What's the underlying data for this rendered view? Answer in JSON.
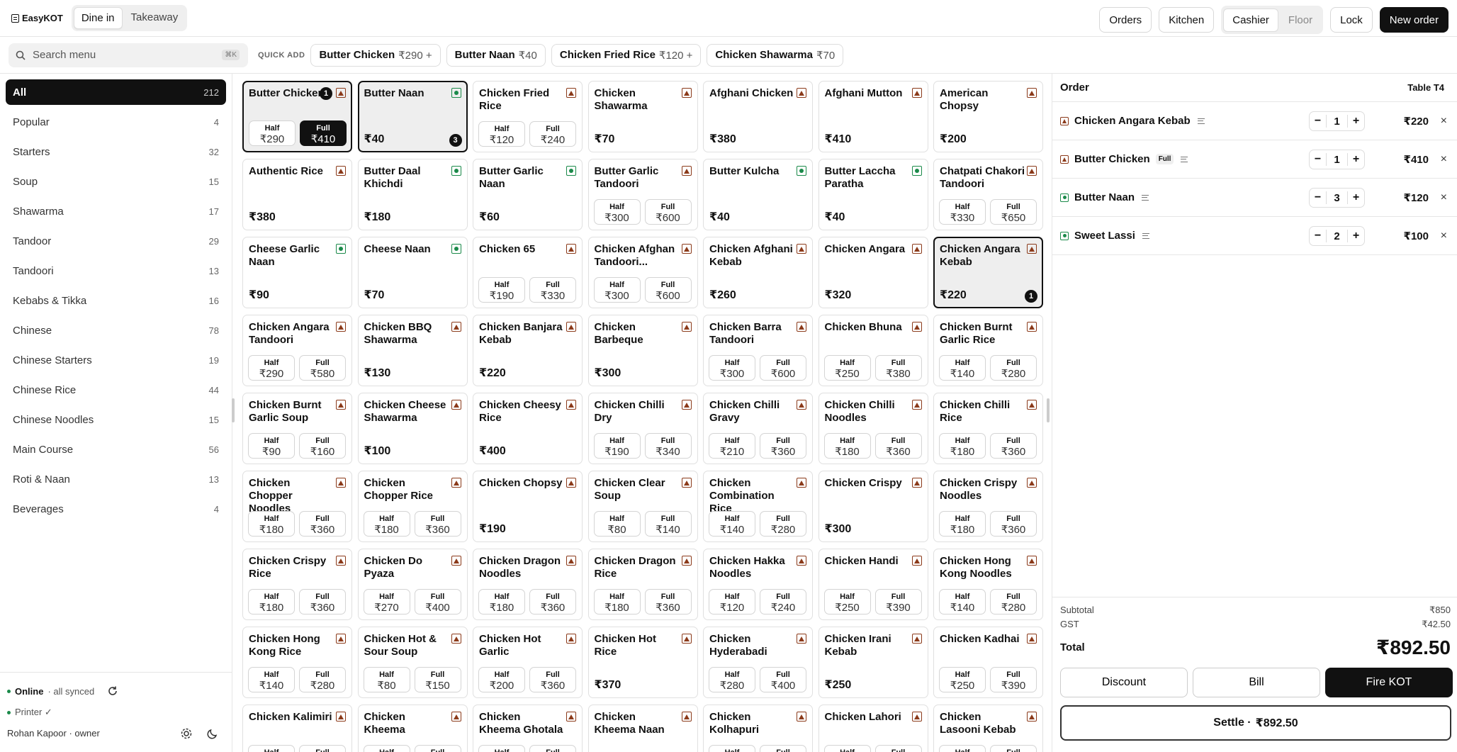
{
  "brand": {
    "name": "EasyKOT"
  },
  "mode_tabs": [
    "Dine in",
    "Takeaway"
  ],
  "header": {
    "orders": "Orders",
    "kitchen": "Kitchen",
    "role_tabs": [
      "Cashier",
      "Floor"
    ],
    "lock": "Lock",
    "new_order": "New order"
  },
  "search": {
    "placeholder": "Search menu",
    "shortcut": "⌘K"
  },
  "quick_add": {
    "label": "QUICK ADD",
    "items": [
      {
        "name": "Butter Chicken",
        "price": "₹290 +"
      },
      {
        "name": "Butter Naan",
        "price": "₹40"
      },
      {
        "name": "Chicken Fried Rice",
        "price": "₹120 +"
      },
      {
        "name": "Chicken Shawarma",
        "price": "₹70"
      }
    ]
  },
  "categories": [
    {
      "name": "All",
      "count": "212"
    },
    {
      "name": "Popular",
      "count": "4"
    },
    {
      "name": "Starters",
      "count": "32"
    },
    {
      "name": "Soup",
      "count": "15"
    },
    {
      "name": "Shawarma",
      "count": "17"
    },
    {
      "name": "Tandoor",
      "count": "29"
    },
    {
      "name": "Tandoori",
      "count": "13"
    },
    {
      "name": "Kebabs & Tikka",
      "count": "16"
    },
    {
      "name": "Chinese",
      "count": "78"
    },
    {
      "name": "Chinese Starters",
      "count": "19"
    },
    {
      "name": "Chinese Rice",
      "count": "44"
    },
    {
      "name": "Chinese Noodles",
      "count": "15"
    },
    {
      "name": "Main Course",
      "count": "56"
    },
    {
      "name": "Roti & Naan",
      "count": "13"
    },
    {
      "name": "Beverages",
      "count": "4"
    }
  ],
  "status": {
    "online": "Online",
    "synced": "· all synced",
    "printer": "Printer ✓",
    "user": "Rohan Kapoor · owner"
  },
  "portion_labels": {
    "half": "Half",
    "full": "Full"
  },
  "menu": [
    {
      "name": "Butter Chicken",
      "veg": false,
      "half": "₹290",
      "full": "₹410",
      "selected": true,
      "badge": "1",
      "full_active": true
    },
    {
      "name": "Butter Naan",
      "veg": true,
      "price": "₹40",
      "selected": true,
      "badge": "3"
    },
    {
      "name": "Chicken Fried Rice",
      "veg": false,
      "half": "₹120",
      "full": "₹240"
    },
    {
      "name": "Chicken Shawarma",
      "veg": false,
      "price": "₹70"
    },
    {
      "name": "Afghani Chicken",
      "veg": false,
      "price": "₹380"
    },
    {
      "name": "Afghani Mutton",
      "veg": false,
      "price": "₹410"
    },
    {
      "name": "American Chopsy",
      "veg": false,
      "price": "₹200"
    },
    {
      "name": "Authentic Rice",
      "veg": false,
      "price": "₹380"
    },
    {
      "name": "Butter Daal Khichdi",
      "veg": true,
      "price": "₹180"
    },
    {
      "name": "Butter Garlic Naan",
      "veg": true,
      "price": "₹60"
    },
    {
      "name": "Butter Garlic Tandoori",
      "veg": false,
      "half": "₹300",
      "full": "₹600"
    },
    {
      "name": "Butter Kulcha",
      "veg": true,
      "price": "₹40"
    },
    {
      "name": "Butter Laccha Paratha",
      "veg": true,
      "price": "₹40"
    },
    {
      "name": "Chatpati Chakori Tandoori",
      "veg": false,
      "half": "₹330",
      "full": "₹650"
    },
    {
      "name": "Cheese Garlic Naan",
      "veg": true,
      "price": "₹90"
    },
    {
      "name": "Cheese Naan",
      "veg": true,
      "price": "₹70"
    },
    {
      "name": "Chicken 65",
      "veg": false,
      "half": "₹190",
      "full": "₹330"
    },
    {
      "name": "Chicken Afghan Tandoori...",
      "veg": false,
      "half": "₹300",
      "full": "₹600"
    },
    {
      "name": "Chicken Afghani Kebab",
      "veg": false,
      "price": "₹260"
    },
    {
      "name": "Chicken Angara",
      "veg": false,
      "price": "₹320"
    },
    {
      "name": "Chicken Angara Kebab",
      "veg": false,
      "price": "₹220",
      "selected": true,
      "badge": "1"
    },
    {
      "name": "Chicken Angara Tandoori",
      "veg": false,
      "half": "₹290",
      "full": "₹580"
    },
    {
      "name": "Chicken BBQ Shawarma",
      "veg": false,
      "price": "₹130"
    },
    {
      "name": "Chicken Banjara Kebab",
      "veg": false,
      "price": "₹220"
    },
    {
      "name": "Chicken Barbeque",
      "veg": false,
      "price": "₹300"
    },
    {
      "name": "Chicken Barra Tandoori",
      "veg": false,
      "half": "₹300",
      "full": "₹600"
    },
    {
      "name": "Chicken Bhuna",
      "veg": false,
      "half": "₹250",
      "full": "₹380"
    },
    {
      "name": "Chicken Burnt Garlic Rice",
      "veg": false,
      "half": "₹140",
      "full": "₹280"
    },
    {
      "name": "Chicken Burnt Garlic Soup",
      "veg": false,
      "half": "₹90",
      "full": "₹160"
    },
    {
      "name": "Chicken Cheese Shawarma",
      "veg": false,
      "price": "₹100"
    },
    {
      "name": "Chicken Cheesy Rice",
      "veg": false,
      "price": "₹400"
    },
    {
      "name": "Chicken Chilli Dry",
      "veg": false,
      "half": "₹190",
      "full": "₹340"
    },
    {
      "name": "Chicken Chilli Gravy",
      "veg": false,
      "half": "₹210",
      "full": "₹360"
    },
    {
      "name": "Chicken Chilli Noodles",
      "veg": false,
      "half": "₹180",
      "full": "₹360"
    },
    {
      "name": "Chicken Chilli Rice",
      "veg": false,
      "half": "₹180",
      "full": "₹360"
    },
    {
      "name": "Chicken Chopper Noodles",
      "veg": false,
      "half": "₹180",
      "full": "₹360"
    },
    {
      "name": "Chicken Chopper Rice",
      "veg": false,
      "half": "₹180",
      "full": "₹360"
    },
    {
      "name": "Chicken Chopsy",
      "veg": false,
      "price": "₹190"
    },
    {
      "name": "Chicken Clear Soup",
      "veg": false,
      "half": "₹80",
      "full": "₹140"
    },
    {
      "name": "Chicken Combination Rice",
      "veg": false,
      "half": "₹140",
      "full": "₹280"
    },
    {
      "name": "Chicken Crispy",
      "veg": false,
      "price": "₹300"
    },
    {
      "name": "Chicken Crispy Noodles",
      "veg": false,
      "half": "₹180",
      "full": "₹360"
    },
    {
      "name": "Chicken Crispy Rice",
      "veg": false,
      "half": "₹180",
      "full": "₹360"
    },
    {
      "name": "Chicken Do Pyaza",
      "veg": false,
      "half": "₹270",
      "full": "₹400"
    },
    {
      "name": "Chicken Dragon Noodles",
      "veg": false,
      "half": "₹180",
      "full": "₹360"
    },
    {
      "name": "Chicken Dragon Rice",
      "veg": false,
      "half": "₹180",
      "full": "₹360"
    },
    {
      "name": "Chicken Hakka Noodles",
      "veg": false,
      "half": "₹120",
      "full": "₹240"
    },
    {
      "name": "Chicken Handi",
      "veg": false,
      "half": "₹250",
      "full": "₹390"
    },
    {
      "name": "Chicken Hong Kong Noodles",
      "veg": false,
      "half": "₹140",
      "full": "₹280"
    },
    {
      "name": "Chicken Hong Kong Rice",
      "veg": false,
      "half": "₹140",
      "full": "₹280"
    },
    {
      "name": "Chicken Hot & Sour Soup",
      "veg": false,
      "half": "₹80",
      "full": "₹150"
    },
    {
      "name": "Chicken Hot Garlic",
      "veg": false,
      "half": "₹200",
      "full": "₹360"
    },
    {
      "name": "Chicken Hot Rice",
      "veg": false,
      "price": "₹370"
    },
    {
      "name": "Chicken Hyderabadi",
      "veg": false,
      "half": "₹280",
      "full": "₹400"
    },
    {
      "name": "Chicken Irani Kebab",
      "veg": false,
      "price": "₹250"
    },
    {
      "name": "Chicken Kadhai",
      "veg": false,
      "half": "₹250",
      "full": "₹390"
    },
    {
      "name": "Chicken Kalimiri",
      "veg": false,
      "half": "",
      "full": ""
    },
    {
      "name": "Chicken Kheema",
      "veg": false,
      "half": "",
      "full": ""
    },
    {
      "name": "Chicken Kheema Ghotala",
      "veg": false,
      "half": "",
      "full": ""
    },
    {
      "name": "Chicken Kheema Naan",
      "veg": false,
      "price": ""
    },
    {
      "name": "Chicken Kolhapuri",
      "veg": false,
      "half": "",
      "full": ""
    },
    {
      "name": "Chicken Lahori",
      "veg": false,
      "half": "",
      "full": ""
    },
    {
      "name": "Chicken Lasooni Kebab",
      "veg": false,
      "half": "",
      "full": ""
    }
  ],
  "order": {
    "title": "Order",
    "table": "Table T4",
    "lines": [
      {
        "name": "Chicken Angara Kebab",
        "veg": false,
        "variant": "",
        "qty": "1",
        "price": "₹220"
      },
      {
        "name": "Butter Chicken",
        "veg": false,
        "variant": "Full",
        "qty": "1",
        "price": "₹410"
      },
      {
        "name": "Butter Naan",
        "veg": true,
        "variant": "",
        "qty": "3",
        "price": "₹120"
      },
      {
        "name": "Sweet Lassi",
        "veg": true,
        "variant": "",
        "qty": "2",
        "price": "₹100"
      }
    ],
    "subtotal_label": "Subtotal",
    "subtotal": "₹850",
    "gst_label": "GST",
    "gst": "₹42.50",
    "total_label": "Total",
    "total": "₹892.50",
    "discount": "Discount",
    "bill": "Bill",
    "fire": "Fire KOT",
    "settle_label": "Settle ·",
    "settle_amount": "₹892.50"
  },
  "colors": {
    "accent": "#111111",
    "veg": "#1b8a4a",
    "nonveg": "#8b3a1a"
  }
}
